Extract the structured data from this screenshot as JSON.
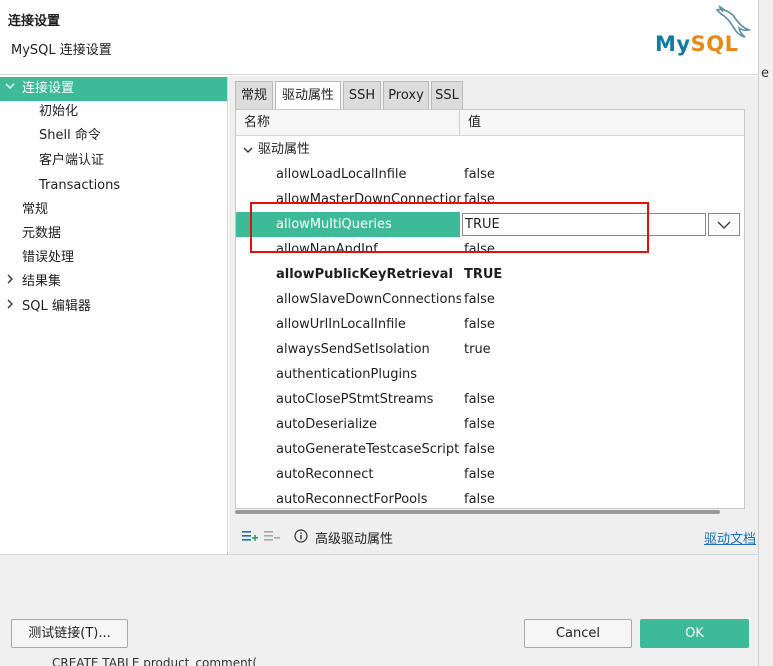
{
  "header": {
    "title": "连接设置",
    "subtitle": "MySQL 连接设置",
    "logo": {
      "text_my": "My",
      "text_sql": "SQL",
      "colors": {
        "my": "#117ba3",
        "sql": "#e58a16"
      }
    }
  },
  "edge_glyph": "e",
  "sidebar": {
    "items": [
      {
        "label": "连接设置",
        "expanded": true,
        "selected": true
      },
      {
        "label": "初始化"
      },
      {
        "label": "Shell 命令"
      },
      {
        "label": "客户端认证"
      },
      {
        "label": "Transactions"
      },
      {
        "label": "常规"
      },
      {
        "label": "元数据"
      },
      {
        "label": "错误处理"
      },
      {
        "label": "结果集",
        "expandable": true
      },
      {
        "label": "SQL 编辑器",
        "expandable": true
      }
    ]
  },
  "tabs": [
    {
      "label": "常规"
    },
    {
      "label": "驱动属性",
      "active": true
    },
    {
      "label": "SSH"
    },
    {
      "label": "Proxy"
    },
    {
      "label": "SSL"
    }
  ],
  "table": {
    "columns": [
      "名称",
      "值"
    ],
    "group": "驱动属性",
    "rows": [
      {
        "name": "allowLoadLocalInfile",
        "value": "false"
      },
      {
        "name": "allowMasterDownConnections",
        "value": "false"
      },
      {
        "name": "allowMultiQueries",
        "value": "TRUE",
        "selected": true
      },
      {
        "name": "allowNanAndInf",
        "value": "false"
      },
      {
        "name": "allowPublicKeyRetrieval",
        "value": "TRUE",
        "bold": true
      },
      {
        "name": "allowSlaveDownConnections",
        "value": "false"
      },
      {
        "name": "allowUrlInLocalInfile",
        "value": "false"
      },
      {
        "name": "alwaysSendSetIsolation",
        "value": "true"
      },
      {
        "name": "authenticationPlugins",
        "value": ""
      },
      {
        "name": "autoClosePStmtStreams",
        "value": "false"
      },
      {
        "name": "autoDeserialize",
        "value": "false"
      },
      {
        "name": "autoGenerateTestcaseScript",
        "value": "false"
      },
      {
        "name": "autoReconnect",
        "value": "false"
      },
      {
        "name": "autoReconnectForPools",
        "value": "false"
      }
    ]
  },
  "pane_footer": {
    "add_icon": "add-property-icon",
    "remove_icon": "remove-property-icon",
    "info_icon": "info-icon",
    "advanced_label": "高级驱动属性",
    "docs_link": "驱动文档"
  },
  "buttons": {
    "test": "测试链接(T)...",
    "cancel": "Cancel",
    "ok": "OK"
  },
  "behind_text": "CREATE TABLE product_comment("
}
